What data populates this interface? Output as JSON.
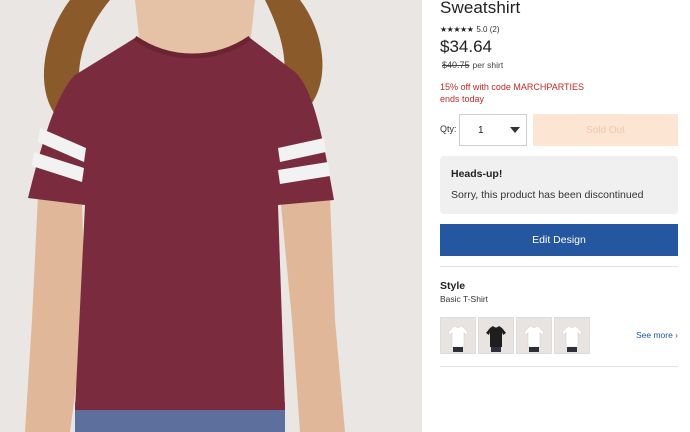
{
  "product": {
    "title": "Sweatshirt",
    "rating": {
      "stars": "★★★★★",
      "score_text": "5.0 (2)",
      "value": 5.0
    },
    "price": "$34.64",
    "original_price": "$40.75",
    "per_unit": "per shirt",
    "promo_line1": "15% off with code MARCHPARTIES",
    "promo_line2": "ends today"
  },
  "purchase": {
    "qty_label": "Qty:",
    "qty_value": "1",
    "sold_out_label": "Sold Out"
  },
  "notice": {
    "title": "Heads-up!",
    "body": "Sorry, this product has been discontinued"
  },
  "edit_button_label": "Edit Design",
  "style": {
    "heading": "Style",
    "selected": "Basic T-Shirt",
    "thumbnails": [
      {
        "shirt_color": "#ffffff"
      },
      {
        "shirt_color": "#1e1e1e"
      },
      {
        "shirt_color": "#ffffff"
      },
      {
        "shirt_color": "#ffffff"
      }
    ],
    "see_more_label": "See more ›"
  },
  "colors": {
    "accent": "#24579f",
    "promo": "#c62828",
    "sold_out_bg": "#fde5d3",
    "shirt": "#7b2b3e"
  }
}
